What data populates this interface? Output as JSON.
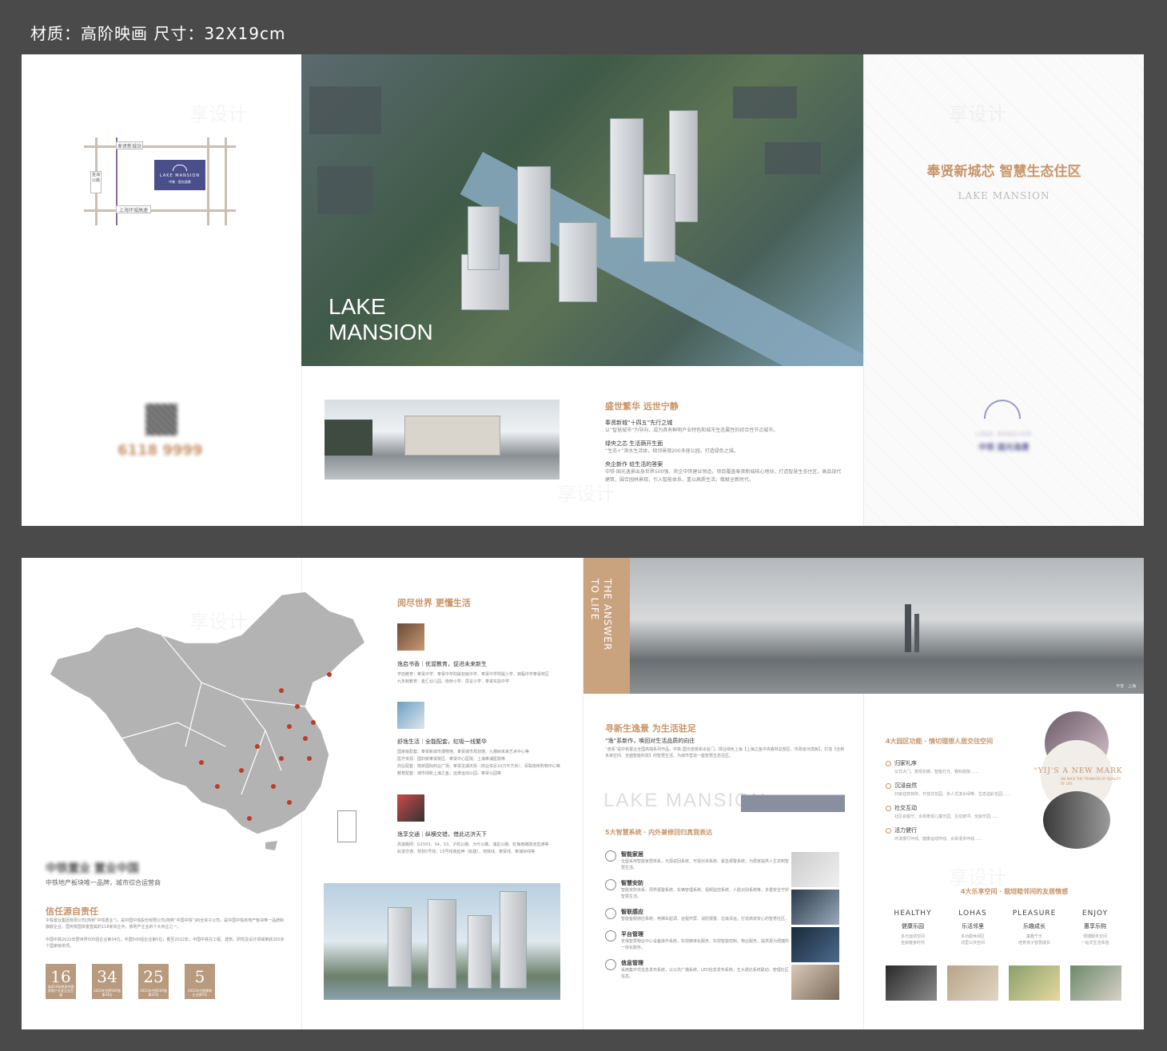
{
  "header": {
    "title": "材质：高阶映画 尺寸：32X19cm"
  },
  "sheet1": {
    "map": {
      "roads": [
        "奉贤新城站",
        "金海公路",
        "上海环城高速"
      ],
      "badge": "LAKE MANSION",
      "badge_cn": "中铁 · 国光逸景"
    },
    "hotline": "6118 9999",
    "brand_en": "LAKE\nMANSION",
    "headline": "奉贤新城芯 智慧生态住区",
    "headline_en": "LAKE MANSION",
    "logo_en": "LAKE MANSION",
    "logo_cn": "中铁 国光逸景",
    "section": {
      "title": "盛世繁华 远世宁静",
      "items": [
        {
          "title": "奉贤新城“十四五”先行之城",
          "desc": "以“智慧城市”为导向，成为具有鲜明产业特色和城市生态属性的综合性节点城市。"
        },
        {
          "title": "绿央之芯 生活荫开生面",
          "desc": "“生态+”滨水生活体，相邻景观200多座公园，打造绿色之城。"
        },
        {
          "title": "央企新作 给生活的答案",
          "desc": "中铁·国光逸景出身世界500强，央企中铁建业领造，项目覆盖奉贤新城核心地块，打造智慧生态住区，高品现代建筑，围合园林景观，引入智能体系，重以高质生活，敬献全新时代。"
        }
      ]
    }
  },
  "sheet2": {
    "china": {
      "tagline": "中铁置业 置业中国",
      "sub": "中铁地产板块唯一品牌，城市综合运营商",
      "trust_title": "信任源自责任",
      "trust_text": "中铁置业集团有限公司(简称“中铁置业”)，是中国中铁股份有限公司(简称“中国中铁”)的全资子公司，是中国中铁房地产板块唯一品牌和旗舰企业。国务院国资委直属的118家央企中，房地产主业的十大央企之一。",
      "trust_text2": "中国中铁2022年居世界500强企业第34位，中国500强企业第5位，截至2022年，中国中铁在工程、建筑、研究及设计领域荣获200多个国家级奖项。",
      "stats": [
        {
          "value": "16",
          "label": "连续16年跻身中国房地产开发企业百强"
        },
        {
          "value": "34",
          "label": "2022年世界500强第34位"
        },
        {
          "value": "25",
          "label": "2022年中国500强第25位"
        },
        {
          "value": "5",
          "label": "2022年中国建筑企业第5位"
        }
      ]
    },
    "life": {
      "title": "阅尽世界 更懂生活",
      "blocks": [
        {
          "title": "逸启书香｜优渥教育，促进未来新生",
          "lines": [
            "学前教育：奉贤中学、奉贤中学附属初级中学、奉贤中学附属小学、锦程中学奉贤校区",
            "九年制教育：金汇幼儿园、南桥小学、思言小学、奉贤实验中学"
          ]
        },
        {
          "title": "舒逸生活｜全能配套，虹吸一线繁华",
          "lines": [
            "国家级配套：奉贤新城市博物馆、奉贤城市规划馆、九棵树未来艺术中心等",
            "医疗资源：国妇婴奉贤院区、奉贤中心医院、上海奉浦医院等",
            "商业配套：南桥国际商业广场、奉贤龙湖天街（商业体近10万平方米）、百联南桥购物中心等",
            "教育配套：城市绿新上海之鱼，远景运动公园，奉贤公园等"
          ]
        },
        {
          "title": "逸享交通｜纵横交错，借此达济天下",
          "lines": [
            "高速路网：G1503、S4、S3、沪杭公路、大叶公路、浦星公路、虹梅南路隧道直通等",
            "轨道交通：规划5号线、15号线南延伸（拟建）、地铁线、奉贤线、奉浦快线等"
          ]
        }
      ]
    },
    "answer": {
      "vertical": "THE ANSWER\nTO LIFE",
      "caption": "平安 · 上海"
    },
    "new_life": {
      "title": "寻新生逸景 为生活驻足",
      "quote": "“逸”系新作，唤回对生活品质的向往",
      "desc": "“逸系”是中铁置业全国高端系列作品，中铁·国光逸景系出名门，择址绿色上海【上海之鱼中央森林总部区、市政级河滨板】，打造【全新未来空间、全面智能科技】的智慧生活，为城市营造一座智慧生态住区。",
      "skyline_text": "LAKE MANSION",
      "smart_title": "5大智慧系统 · 内外兼修回归真我表达",
      "smart": [
        {
          "title": "智能家居",
          "desc": "全屋采用智能家居体系，光源返回系统、可视对讲系统、紧急报警系统，为居家提供人生定制智慧生活。"
        },
        {
          "title": "智慧安防",
          "desc": "智能安防体系，周界报警系统、车辆管理系统、视频监控系统、人脸识别系统等，多重安全守护智慧生活。"
        },
        {
          "title": "智联感应",
          "desc": "智能客服感应系统，电梯车起调、远程开屏、消防报警、垃圾清运，打造高效安心的智慧社区。"
        },
        {
          "title": "平台管理",
          "desc": "安保智慧物业中心设备操作系统，实现精准化服务，实现智能控制、物业服务，提供更为便捷的一体化服务。"
        },
        {
          "title": "信息管理",
          "desc": "采用集中式信息发布系统，以公共广播系统、LED信息发布系统，五大通达系统联动，管理社区信息。"
        }
      ]
    },
    "zones": {
      "title": "4大园区功能 · 情切理想人居交往空间",
      "items": [
        {
          "title": "归家礼序",
          "desc": "仪式大门、景观长廊、智能灯光、春秋庭院……"
        },
        {
          "title": "沉浸自然",
          "desc": "归家迎宾林阵、开放式花园、多人式滨水绿带、生态溢彩花园……"
        },
        {
          "title": "社交互动",
          "desc": "社区会客厅、水岸景观儿童乐园、互动家坪、全龄乐园……"
        },
        {
          "title": "活力健行",
          "desc": "环滨慢行环线、健康运动环线、水岸漫步环线……"
        }
      ],
      "circle_text": "“YIJ'S A NEW MARK",
      "circle_sub": "WE BACK THE TRANSFER OF QUALITY OF LIFE"
    },
    "enjoy": {
      "title": "4大乐享空间 · 栽培睦邻间的友居情感",
      "cols": [
        {
          "en": "HEALTHY",
          "cn": "健康乐园",
          "sub": "多元运动空间\n全龄健身时代"
        },
        {
          "en": "LOHAS",
          "cn": "乐活邻里",
          "sub": "多功能休闲区\n邻里公共空间"
        },
        {
          "en": "PLEASURE",
          "cn": "乐趣成长",
          "sub": "童趣千乐\n培育孩子智慧成长"
        },
        {
          "en": "ENJOY",
          "cn": "惠享乐购",
          "sub": "便捷服务空间\n一站式生活体验"
        }
      ]
    }
  },
  "watermark": "享设计",
  "colors": {
    "accent": "#c8956a",
    "badge": "#4a4f8c",
    "stat": "#b89a7e",
    "background": "#4a4a4a"
  }
}
